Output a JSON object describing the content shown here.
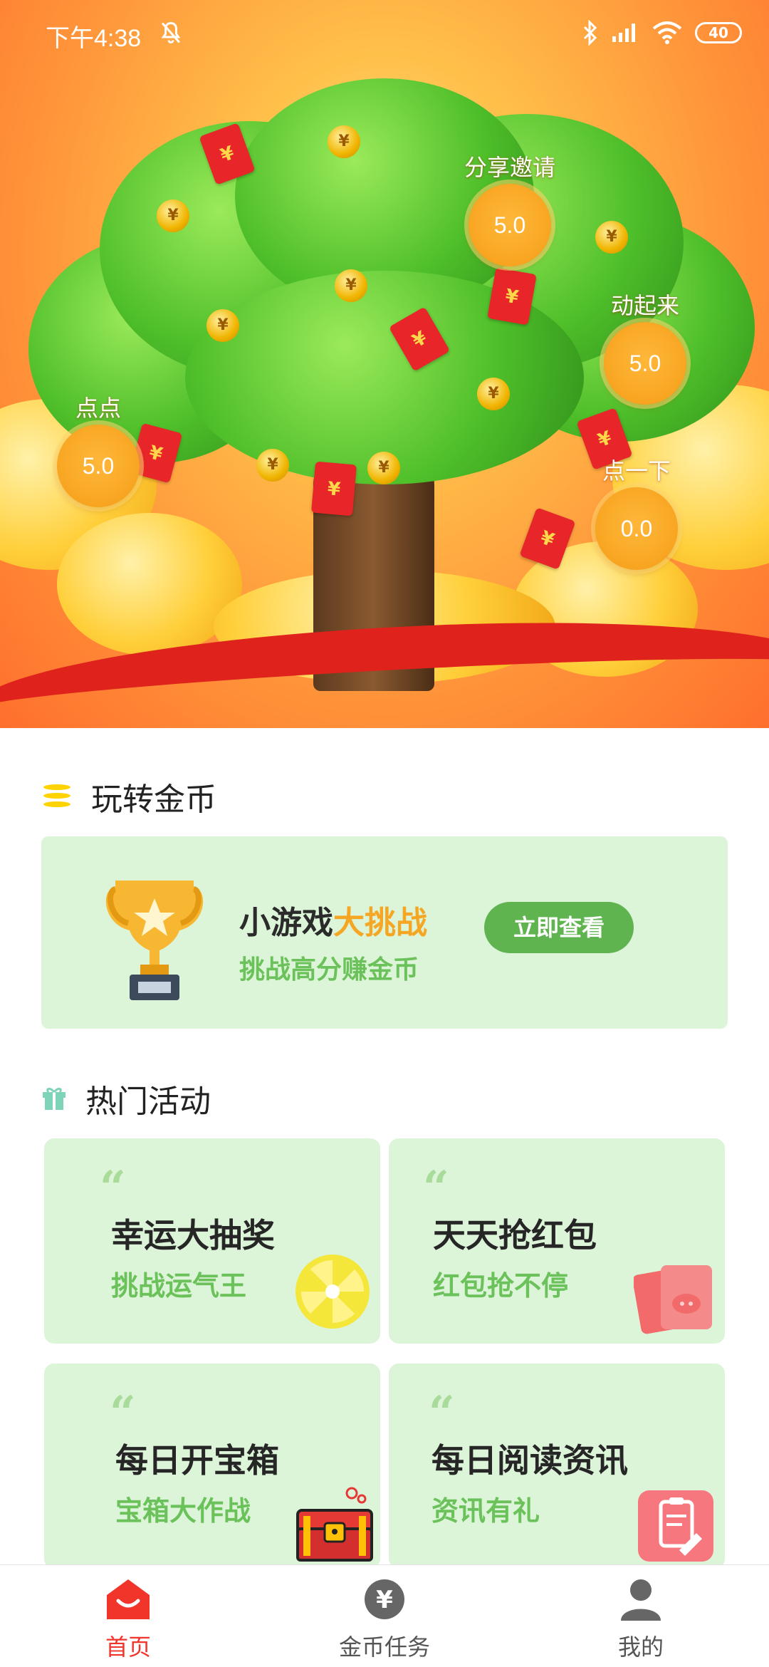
{
  "status_bar": {
    "time": "下午4:38",
    "battery": "40"
  },
  "tree_coins": [
    {
      "label": "分享邀请",
      "value": "5.0"
    },
    {
      "label": "动起来",
      "value": "5.0"
    },
    {
      "label": "点点",
      "value": "5.0"
    },
    {
      "label": "点一下",
      "value": "0.0"
    }
  ],
  "sections": {
    "coins": {
      "title": "玩转金币",
      "icon": "coins-icon"
    },
    "hot": {
      "title": "热门活动",
      "icon": "gift-icon"
    }
  },
  "game_banner": {
    "title_main": "小游戏",
    "title_highlight": "大挑战",
    "subtitle": "挑战高分赚金币",
    "button": "立即查看"
  },
  "activities": [
    {
      "quote": "“",
      "title": "幸运大抽奖",
      "subtitle": "挑战运气王",
      "icon": "lucky-wheel-icon"
    },
    {
      "quote": "“",
      "title": "天天抢红包",
      "subtitle": "红包抢不停",
      "icon": "red-envelope-icon"
    },
    {
      "quote": "“",
      "title": "每日开宝箱",
      "subtitle": "宝箱大作战",
      "icon": "treasure-chest-icon"
    },
    {
      "quote": "“",
      "title": "每日阅读资讯",
      "subtitle": "资讯有礼",
      "icon": "news-clipboard-icon"
    }
  ],
  "bottom_nav": [
    {
      "label": "首页",
      "icon": "home-icon",
      "active": true
    },
    {
      "label": "金币任务",
      "icon": "yen-coin-icon",
      "active": false
    },
    {
      "label": "我的",
      "icon": "profile-icon",
      "active": false
    }
  ],
  "colors": {
    "accent_red": "#f2352b",
    "green": "#5fb450",
    "card_bg": "#dcf4d8",
    "coin": "#f9a825"
  }
}
